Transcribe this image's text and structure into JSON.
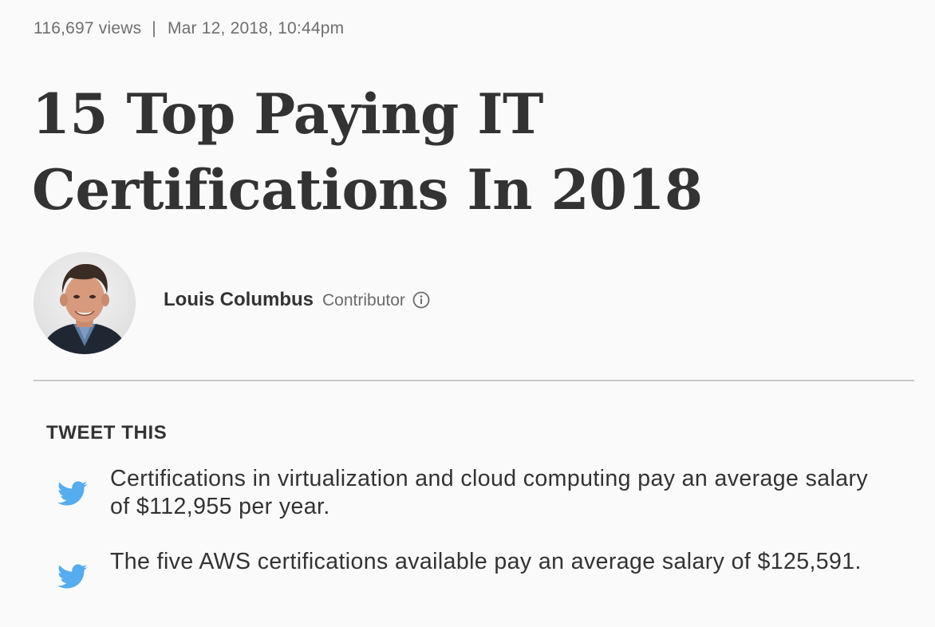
{
  "meta": {
    "views": "116,697 views",
    "separator": "|",
    "date": "Mar 12, 2018, 10:44pm"
  },
  "article": {
    "title_line1": "15 Top Paying IT",
    "title_line2": "Certifications In 2018"
  },
  "author": {
    "name": "Louis Columbus",
    "role": "Contributor",
    "info_icon": "info-circle-icon"
  },
  "tweet_this": {
    "heading": "TWEET THIS",
    "icon": "twitter-bird-icon",
    "icon_color": "#55acee",
    "items": [
      {
        "text": "Certifications in virtualization and cloud computing pay an average salary of $112,955 per year."
      },
      {
        "text": "The five AWS certifications available pay an average salary of $125,591."
      }
    ]
  },
  "colors": {
    "background": "#fafafa",
    "text": "#333333",
    "muted": "#6f6f6f",
    "divider": "#c8c8c8"
  }
}
